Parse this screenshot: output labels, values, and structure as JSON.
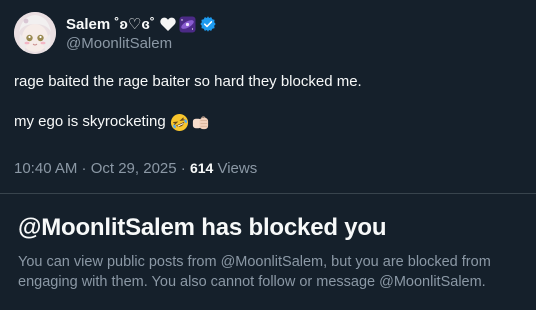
{
  "user": {
    "display_name": "Salem ˚ʚ♡ɞ˚",
    "handle": "@MoonlitSalem",
    "verified": true
  },
  "tweet": {
    "line1": "rage baited the rage baiter so hard they blocked me.",
    "line2": "my ego is skyrocketing",
    "time": "10:40 AM · Oct 29, 2025 · ",
    "views_count": "614",
    "views_label": " Views"
  },
  "blocked_notice": {
    "title": "@MoonlitSalem has blocked you",
    "description": "You can view public posts from @MoonlitSalem, but you are blocked from engaging with them. You also cannot follow or message @MoonlitSalem."
  },
  "colors": {
    "background": "#15202b",
    "primary_text": "#f7f9f9",
    "secondary_text": "#8b98a5",
    "verified_blue": "#1d9bf0",
    "divider": "#38444d"
  },
  "icons": [
    "avatar",
    "white-heart-icon",
    "galaxy-emoji-icon",
    "verified-badge-icon",
    "rofl-emoji-icon",
    "fist-bump-emoji-icon"
  ]
}
